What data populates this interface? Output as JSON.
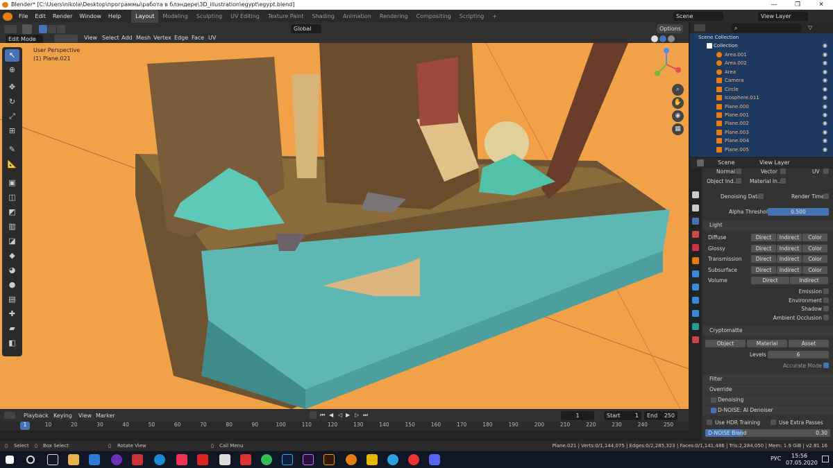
{
  "titlebar": {
    "title": "Blender* [C:\\Users\\nikola\\Desktop\\программы\\работа в блэндере\\3D_illustration\\egypt\\egypt.blend]",
    "controls": [
      "—",
      "❐",
      "✕"
    ]
  },
  "menu": [
    "File",
    "Edit",
    "Render",
    "Window",
    "Help"
  ],
  "workspaces": [
    "Layout",
    "Modeling",
    "Sculpting",
    "UV Editing",
    "Texture Paint",
    "Shading",
    "Animation",
    "Rendering",
    "Compositing",
    "Scripting"
  ],
  "active_workspace": "Layout",
  "scene": {
    "name": "Scene",
    "view_layer": "View Layer"
  },
  "viewport": {
    "mode": "Edit Mode",
    "menu": [
      "View",
      "Select",
      "Add",
      "Mesh",
      "Vertex",
      "Edge",
      "Face",
      "UV"
    ],
    "orientation": "Global",
    "options": "Options",
    "perspective": "User Perspective",
    "object": "(1) Plane.021"
  },
  "outliner": {
    "root": "Scene Collection",
    "items": [
      {
        "name": "Collection",
        "type": "collection"
      },
      {
        "name": "Area.001",
        "type": "light"
      },
      {
        "name": "Area.002",
        "type": "light"
      },
      {
        "name": "Area",
        "type": "light"
      },
      {
        "name": "Camera",
        "type": "camera"
      },
      {
        "name": "Circle",
        "type": "mesh"
      },
      {
        "name": "Icosphere.011",
        "type": "mesh"
      },
      {
        "name": "Plane.000",
        "type": "mesh"
      },
      {
        "name": "Plane.001",
        "type": "mesh"
      },
      {
        "name": "Plane.002",
        "type": "mesh"
      },
      {
        "name": "Plane.003",
        "type": "mesh"
      },
      {
        "name": "Plane.004",
        "type": "mesh"
      },
      {
        "name": "Plane.005",
        "type": "mesh"
      }
    ]
  },
  "properties": {
    "breadcrumb": [
      "Scene",
      "View Layer"
    ],
    "passes_top": [
      "Normal",
      "Vector",
      "UV",
      "Object Ind...",
      "Material In..."
    ],
    "denoising_data": "Denoising Data",
    "render_time": "Render Time",
    "alpha_threshold_label": "Alpha Threshold",
    "alpha_threshold": "0.500",
    "light": {
      "title": "Light",
      "rows": [
        {
          "label": "Diffuse",
          "buttons": [
            "Direct",
            "Indirect",
            "Color"
          ]
        },
        {
          "label": "Glossy",
          "buttons": [
            "Direct",
            "Indirect",
            "Color"
          ]
        },
        {
          "label": "Transmission",
          "buttons": [
            "Direct",
            "Indirect",
            "Color"
          ]
        },
        {
          "label": "Subsurface",
          "buttons": [
            "Direct",
            "Indirect",
            "Color"
          ]
        },
        {
          "label": "Volume",
          "buttons": [
            "Direct",
            "Indirect"
          ]
        }
      ],
      "toggles": [
        "Emission",
        "Environment",
        "Shadow",
        "Ambient Occlusion"
      ]
    },
    "cryptomatte": {
      "title": "Cryptomatte",
      "buttons": [
        "Object",
        "Material",
        "Asset"
      ],
      "levels_label": "Levels",
      "levels": "6",
      "accurate": "Accurate Mode"
    },
    "sections": [
      "Filter",
      "Override",
      "Denoising",
      "D-NOISE: AI Denoiser"
    ],
    "hdr": "Use HDR Training",
    "extra": "Use Extra Passes",
    "blend_label": "D-NOISE Blend",
    "blend": "0.30"
  },
  "timeline": {
    "menu": [
      "Playback",
      "Keying",
      "View",
      "Marker"
    ],
    "current": "1",
    "start_label": "Start",
    "start": "1",
    "end_label": "End",
    "end": "250",
    "ticks": [
      "1",
      "10",
      "20",
      "30",
      "40",
      "50",
      "60",
      "70",
      "80",
      "90",
      "100",
      "110",
      "120",
      "130",
      "140",
      "150",
      "160",
      "170",
      "180",
      "190",
      "200",
      "210",
      "220",
      "230",
      "240",
      "250"
    ]
  },
  "statusbar": {
    "select": "Select",
    "box_select": "Box Select",
    "rotate": "Rotate View",
    "call_menu": "Call Menu",
    "stats": "Plane.021 | Verts:0/1,144,075 | Edges:0/2,285,323 | Faces:0/1,141,486 | Tris:2,284,050 | Mem: 1.9 GiB | v2.81.16"
  },
  "taskbar": {
    "lang": "РУС",
    "time": "15:56",
    "date": "07.05.2020"
  },
  "colors": {
    "accent": "#4772b3",
    "viewport_bg": "#f1a248",
    "water": "#5fb7b4",
    "outliner_sel": "#1f3a61"
  }
}
